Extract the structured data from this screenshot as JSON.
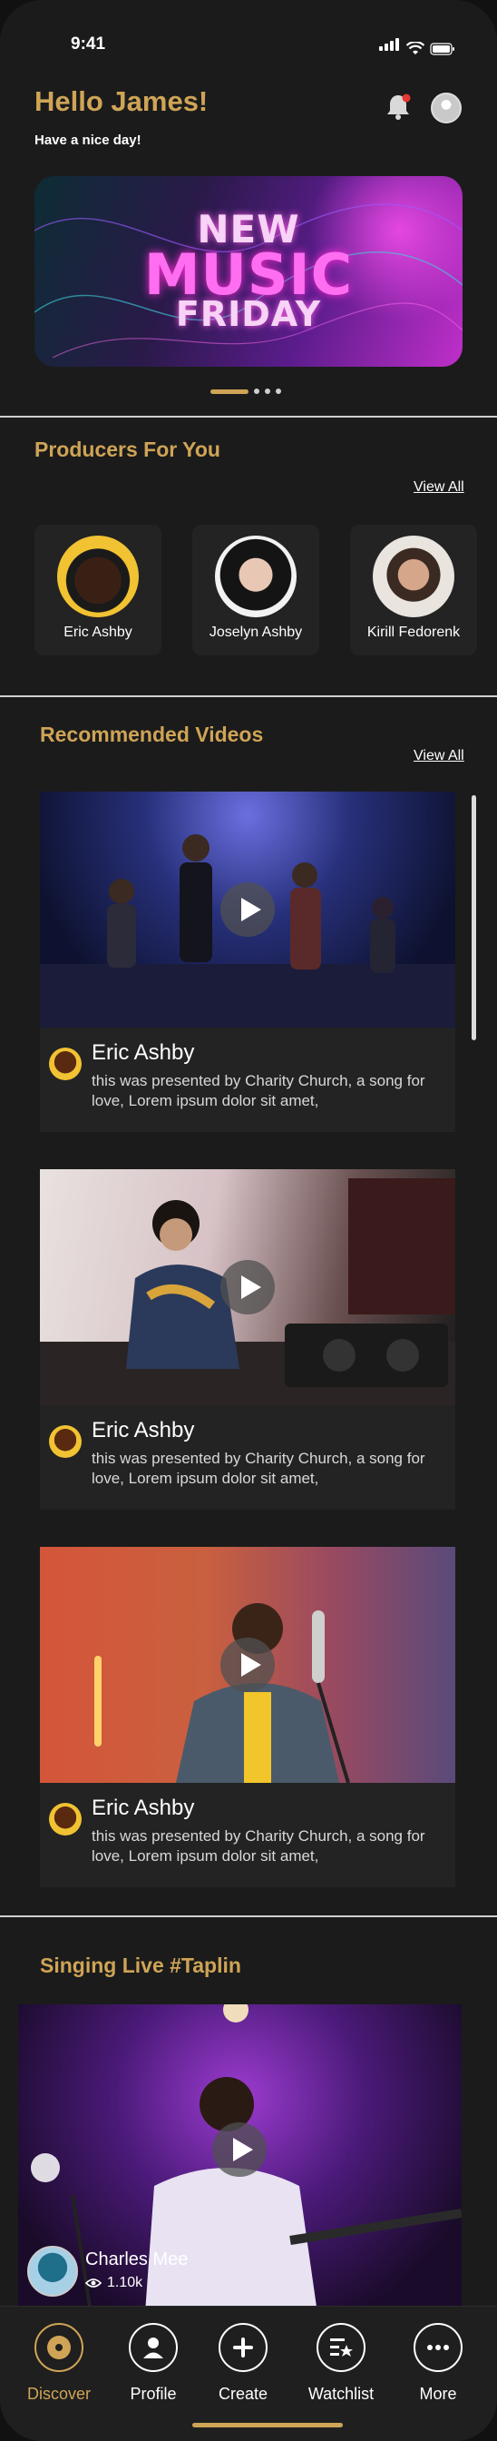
{
  "status_bar": {
    "time": "9:41"
  },
  "header": {
    "greeting": "Hello James!",
    "subtitle": "Have a nice day!"
  },
  "banner": {
    "line1": "NEW",
    "line2": "MUSIC",
    "line3": "FRIDAY"
  },
  "producers_section": {
    "title": "Producers For You",
    "view_all": "View All",
    "items": [
      {
        "name": "Eric Ashby"
      },
      {
        "name": "Joselyn Ashby"
      },
      {
        "name": "Kirill Fedorenk"
      }
    ]
  },
  "videos_section": {
    "title": "Recommended Videos",
    "view_all": "View All",
    "items": [
      {
        "name": "Eric Ashby",
        "description": "this was presented by Charity Church, a song for love, Lorem ipsum dolor sit amet,"
      },
      {
        "name": "Eric Ashby",
        "description": "this was presented by Charity Church, a song for love, Lorem ipsum dolor sit amet,"
      },
      {
        "name": "Eric Ashby",
        "description": "this was presented by Charity Church, a song for love, Lorem ipsum dolor sit amet,"
      }
    ]
  },
  "live_section": {
    "title": "Singing Live #Taplin",
    "performer": "Charles Mee",
    "views": "1.10k"
  },
  "bottom_nav": {
    "items": [
      {
        "label": "Discover",
        "icon": "disc-icon",
        "active": true
      },
      {
        "label": "Profile",
        "icon": "person-icon"
      },
      {
        "label": "Create",
        "icon": "plus-icon"
      },
      {
        "label": "Watchlist",
        "icon": "watchlist-icon"
      },
      {
        "label": "More",
        "icon": "more-icon"
      }
    ]
  },
  "colors": {
    "accent": "#cfa456",
    "background": "#1b1b1b",
    "card": "#232323"
  }
}
